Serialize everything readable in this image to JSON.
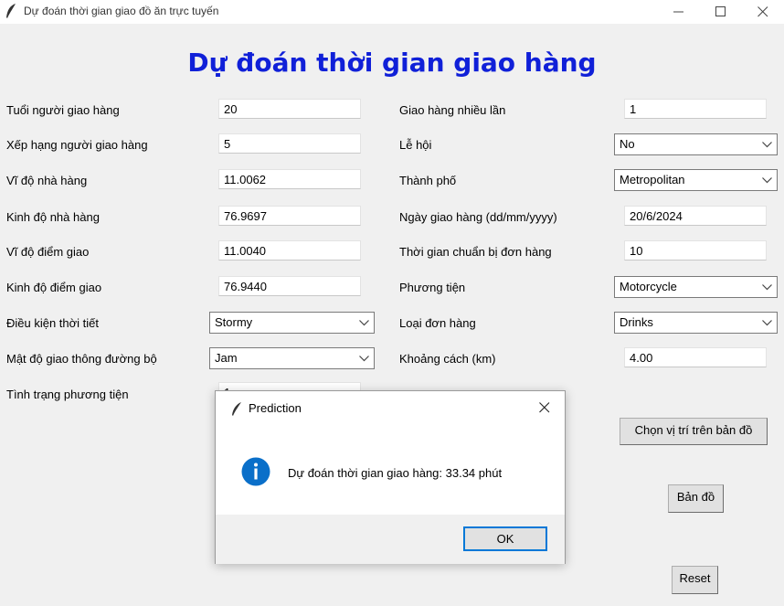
{
  "window": {
    "title": "Dự đoán thời gian giao đồ ăn trực tuyến",
    "minimize_icon": "minimize-icon",
    "maximize_icon": "maximize-icon",
    "close_icon": "close-icon"
  },
  "heading": "Dự đoán thời gian giao hàng",
  "heading_color": "#1020d8",
  "left_fields": [
    {
      "label": "Tuổi người giao hàng",
      "value": "20"
    },
    {
      "label": "Xếp hạng người giao hàng",
      "value": "5"
    },
    {
      "label": "Vĩ độ nhà hàng",
      "value": "11.0062"
    },
    {
      "label": "Kinh độ nhà hàng",
      "value": "76.9697"
    },
    {
      "label": "Vĩ độ điểm giao",
      "value": "11.0040"
    },
    {
      "label": "Kinh độ điểm giao",
      "value": "76.9440"
    },
    {
      "label": "Điều kiện thời tiết",
      "value": "Stormy"
    },
    {
      "label": "Mật độ giao thông đường bộ",
      "value": "Jam"
    },
    {
      "label": "Tình trạng phương tiện",
      "value": "1"
    }
  ],
  "right_fields": [
    {
      "label": "Giao hàng nhiều lần",
      "value": "1"
    },
    {
      "label": "Lễ hội",
      "value": "No"
    },
    {
      "label": "Thành phố",
      "value": "Metropolitan"
    },
    {
      "label": "Ngày giao hàng (dd/mm/yyyy)",
      "value": "20/6/2024"
    },
    {
      "label": "Thời gian chuẩn bị đơn hàng",
      "value": "10"
    },
    {
      "label": "Phương tiện",
      "value": "Motorcycle"
    },
    {
      "label": "Loại đơn hàng",
      "value": "Drinks"
    },
    {
      "label": "Khoảng cách (km)",
      "value": "4.00"
    }
  ],
  "buttons": {
    "choose_map_location": "Chọn vị trí trên bản đồ",
    "map": "Bản đồ",
    "reset": "Reset"
  },
  "dialog": {
    "title": "Prediction",
    "message": "Dự đoán thời gian giao hàng: 33.34 phút",
    "ok_label": "OK",
    "icon": "info-icon",
    "accent": "#0078d7"
  }
}
